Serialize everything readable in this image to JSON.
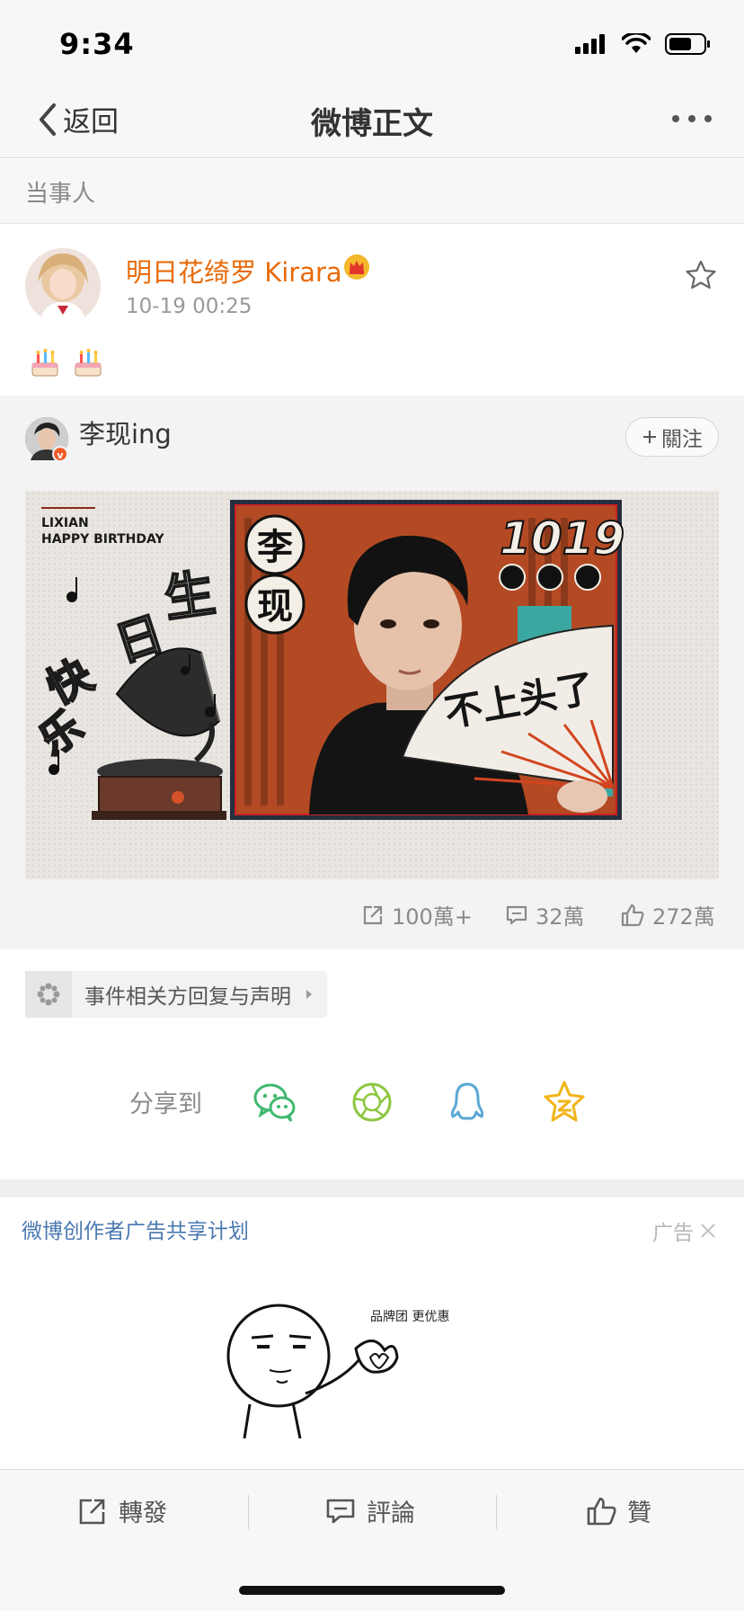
{
  "status_bar": {
    "time": "9:34"
  },
  "nav": {
    "back_label": "返回",
    "title": "微博正文"
  },
  "section": {
    "party_label": "当事人"
  },
  "post": {
    "author": "明日花绮罗 Kirara",
    "time": "10-19 00:25",
    "content_emojis": [
      "🎂",
      "🎂"
    ]
  },
  "repost": {
    "author": "李现ing",
    "follow_label": "關注",
    "image": {
      "brand_line1": "LIXIAN",
      "brand_line2": "HAPPY BIRTHDAY",
      "greeting_chars": [
        "生",
        "日",
        "快",
        "乐"
      ],
      "name_chars": [
        "李",
        "现"
      ],
      "date": "1019",
      "fan_text": "不上头了"
    },
    "stats": {
      "reposts": "100萬+",
      "comments": "32萬",
      "likes": "272萬"
    }
  },
  "topic": {
    "label": "事件相关方回复与声明"
  },
  "share": {
    "label": "分享到",
    "icons": [
      "wechat-icon",
      "moments-icon",
      "qq-icon",
      "qzone-icon"
    ]
  },
  "ad": {
    "title": "微博创作者广告共享计划",
    "label": "广告",
    "caption": "品牌团 更优惠"
  },
  "toolbar": {
    "repost": "轉發",
    "comment": "評論",
    "like": "贊"
  },
  "colors": {
    "orange": "#e86b0b",
    "link_blue": "#4a78b0",
    "wechat_green": "#3fb96f",
    "qq_blue": "#5aa9d6",
    "qzone_yellow": "#f2b418"
  }
}
